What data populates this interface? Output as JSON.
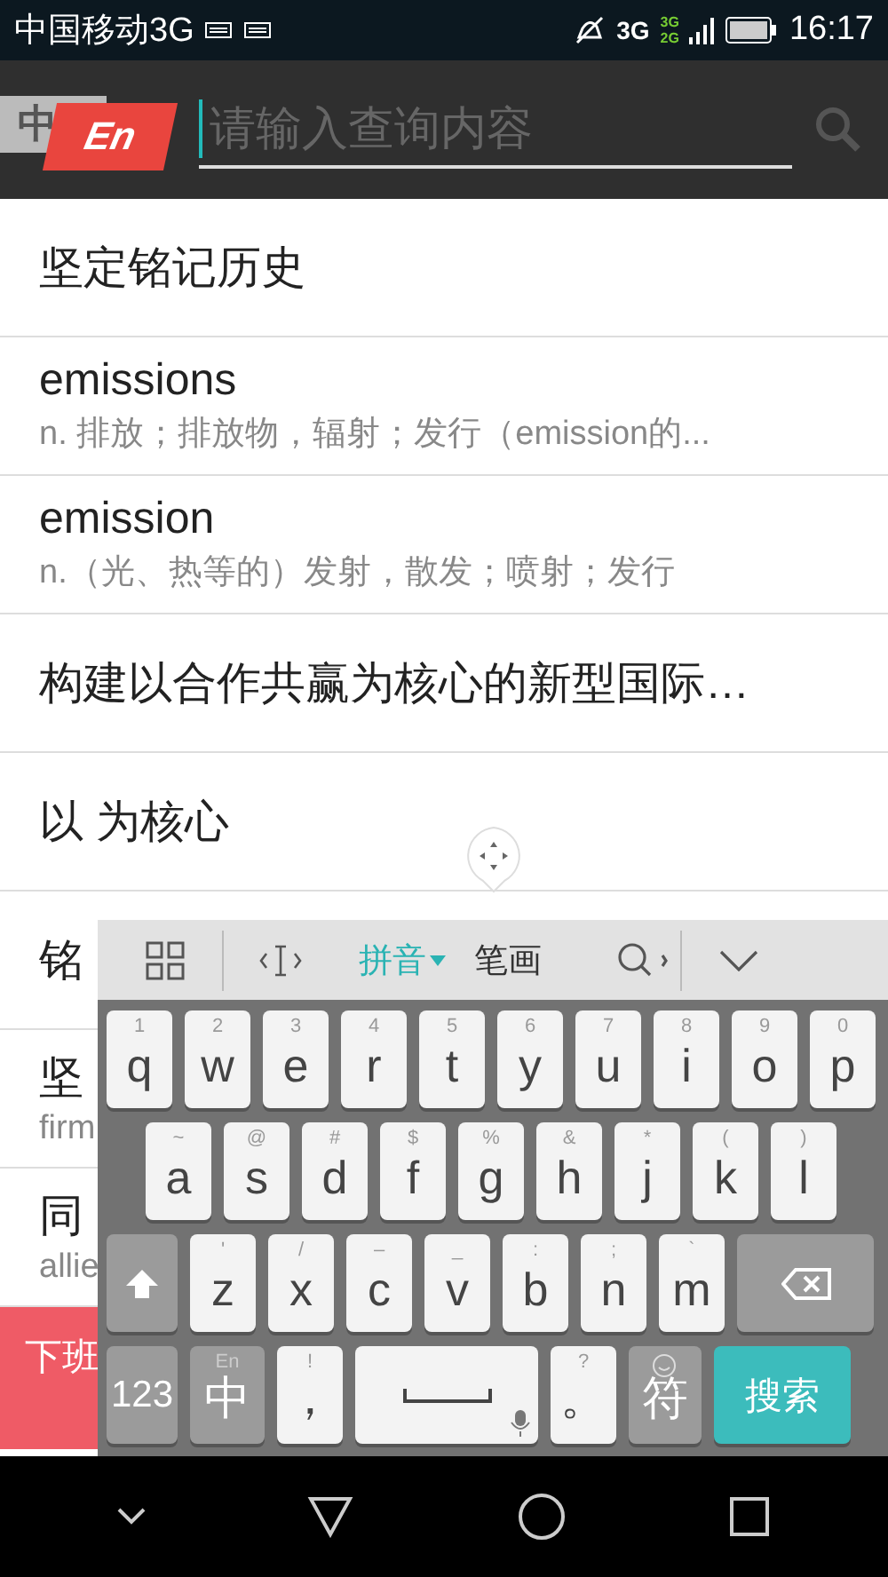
{
  "status_bar": {
    "carrier": "中国移动3G",
    "network": "3G",
    "sim_labels": [
      "3G",
      "2G"
    ],
    "time": "16:17"
  },
  "header": {
    "logo_back": "中",
    "logo_front": "En",
    "search": {
      "placeholder": "请输入查询内容"
    }
  },
  "results": [
    {
      "title": "坚定铭记历史"
    },
    {
      "title": "emissions",
      "subtitle": "n. 排放；排放物，辐射；发行（emission的..."
    },
    {
      "title": "emission",
      "subtitle": "n.（光、热等的）发射，散发；喷射；发行"
    },
    {
      "title": "构建以合作共赢为核心的新型国际…"
    },
    {
      "title": "以 为核心"
    },
    {
      "title": "铭"
    },
    {
      "title": "坚",
      "subtitle": "firm"
    },
    {
      "title": "同",
      "subtitle": "allie"
    }
  ],
  "banner": {
    "text": "下班"
  },
  "keyboard": {
    "modes": [
      {
        "label": "拼音",
        "selected": true
      },
      {
        "label": "笔画",
        "selected": false
      }
    ],
    "rows": [
      {
        "keys": [
          {
            "kind": "char",
            "label": "q",
            "hint": "1"
          },
          {
            "kind": "char",
            "label": "w",
            "hint": "2"
          },
          {
            "kind": "char",
            "label": "e",
            "hint": "3"
          },
          {
            "kind": "char",
            "label": "r",
            "hint": "4"
          },
          {
            "kind": "char",
            "label": "t",
            "hint": "5"
          },
          {
            "kind": "char",
            "label": "y",
            "hint": "6"
          },
          {
            "kind": "char",
            "label": "u",
            "hint": "7"
          },
          {
            "kind": "char",
            "label": "i",
            "hint": "8"
          },
          {
            "kind": "char",
            "label": "o",
            "hint": "9"
          },
          {
            "kind": "char",
            "label": "p",
            "hint": "0"
          }
        ]
      },
      {
        "keys": [
          {
            "kind": "char",
            "label": "a",
            "hint": "~"
          },
          {
            "kind": "char",
            "label": "s",
            "hint": "@"
          },
          {
            "kind": "char",
            "label": "d",
            "hint": "#"
          },
          {
            "kind": "char",
            "label": "f",
            "hint": "$"
          },
          {
            "kind": "char",
            "label": "g",
            "hint": "%"
          },
          {
            "kind": "char",
            "label": "h",
            "hint": "&"
          },
          {
            "kind": "char",
            "label": "j",
            "hint": "*"
          },
          {
            "kind": "char",
            "label": "k",
            "hint": "("
          },
          {
            "kind": "char",
            "label": "l",
            "hint": ")"
          }
        ]
      },
      {
        "keys": [
          {
            "kind": "shift"
          },
          {
            "kind": "char",
            "label": "z",
            "hint": "'"
          },
          {
            "kind": "char",
            "label": "x",
            "hint": "/"
          },
          {
            "kind": "char",
            "label": "c",
            "hint": "–"
          },
          {
            "kind": "char",
            "label": "v",
            "hint": "_"
          },
          {
            "kind": "char",
            "label": "b",
            "hint": ":"
          },
          {
            "kind": "char",
            "label": "n",
            "hint": ";"
          },
          {
            "kind": "char",
            "label": "m",
            "hint": "`"
          },
          {
            "kind": "backspace"
          }
        ]
      },
      {
        "keys": [
          {
            "kind": "mode",
            "label": "123"
          },
          {
            "kind": "mode",
            "label": "中",
            "hint": "En"
          },
          {
            "kind": "char",
            "label": "，",
            "hint": "!"
          },
          {
            "kind": "space"
          },
          {
            "kind": "char",
            "label": "。",
            "hint": "?"
          },
          {
            "kind": "symbol",
            "label": "符"
          },
          {
            "kind": "search",
            "label": "搜索"
          }
        ]
      }
    ]
  }
}
